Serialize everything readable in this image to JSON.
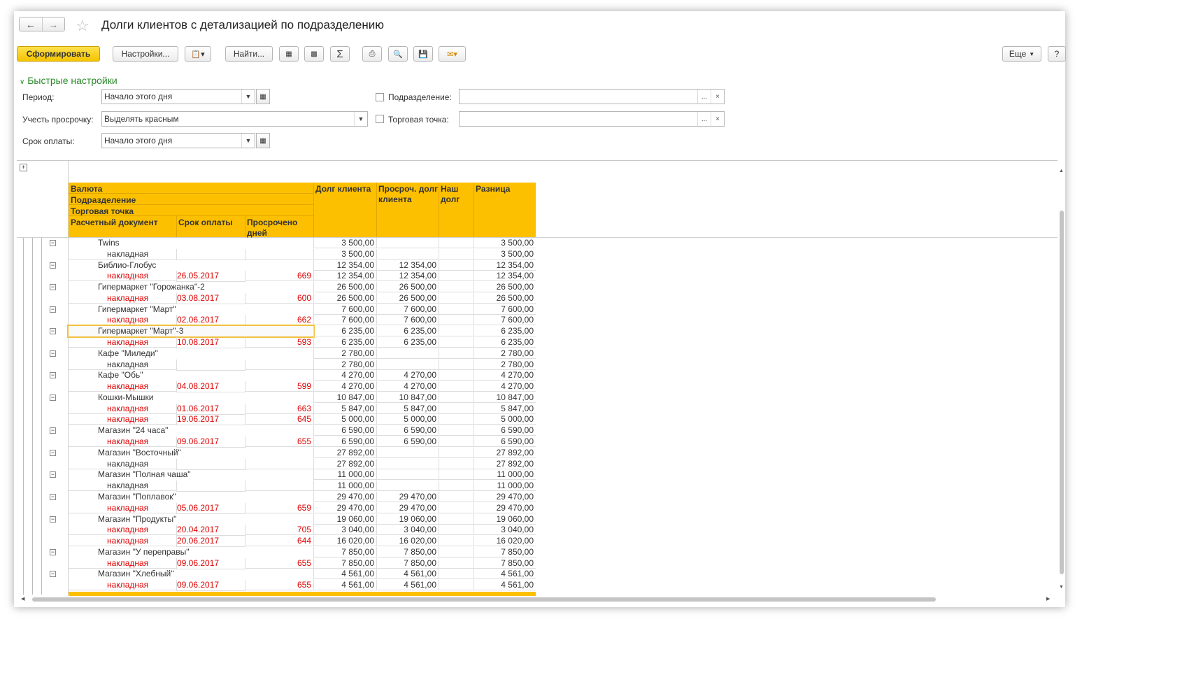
{
  "title": "Долги клиентов с детализацией по подразделению",
  "toolbar": {
    "generate": "Сформировать",
    "settings": "Настройки...",
    "find": "Найти...",
    "sigma": "Σ",
    "more": "Еще",
    "help": "?"
  },
  "quick_settings": {
    "label": "Быстрые настройки",
    "period_label": "Период:",
    "period_value": "Начало этого дня",
    "overdue_label": "Учесть просрочку:",
    "overdue_value": "Выделять красным",
    "due_label": "Срок оплаты:",
    "due_value": "Начало этого дня",
    "division_label": "Подразделение:",
    "outlet_label": "Торговая точка:",
    "dots": "...",
    "clear": "×"
  },
  "header": {
    "h_currency": "Валюта",
    "h_division": "Подразделение",
    "h_outlet": "Торговая точка",
    "h_doc": "Расчетный документ",
    "h_due": "Срок оплаты",
    "h_overdue_days": "Просрочено дней",
    "h_client_debt": "Долг клиента",
    "h_overdue_debt": "Просроч. долг клиента",
    "h_our_debt": "Наш долг",
    "h_diff": "Разница"
  },
  "rows": [
    {
      "t": "g",
      "name": "Twins",
      "debt": "3 500,00",
      "overdue": "",
      "diff": "3 500,00"
    },
    {
      "t": "d",
      "name": "накладная",
      "due": "",
      "days": "",
      "debt": "3 500,00",
      "overdue": "",
      "diff": "3 500,00",
      "red": false
    },
    {
      "t": "g",
      "name": "Библио-Глобус",
      "debt": "12 354,00",
      "overdue": "12 354,00",
      "diff": "12 354,00"
    },
    {
      "t": "d",
      "name": "накладная",
      "due": "26.05.2017",
      "days": "669",
      "debt": "12 354,00",
      "overdue": "12 354,00",
      "diff": "12 354,00",
      "red": true
    },
    {
      "t": "g",
      "name": "Гипермаркет \"Горожанка\"-2",
      "debt": "26 500,00",
      "overdue": "26 500,00",
      "diff": "26 500,00"
    },
    {
      "t": "d",
      "name": "накладная",
      "due": "03.08.2017",
      "days": "600",
      "debt": "26 500,00",
      "overdue": "26 500,00",
      "diff": "26 500,00",
      "red": true
    },
    {
      "t": "g",
      "name": "Гипермаркет \"Март\"",
      "debt": "7 600,00",
      "overdue": "7 600,00",
      "diff": "7 600,00"
    },
    {
      "t": "d",
      "name": "накладная",
      "due": "02.06.2017",
      "days": "662",
      "debt": "7 600,00",
      "overdue": "7 600,00",
      "diff": "7 600,00",
      "red": true
    },
    {
      "t": "g",
      "name": "Гипермаркет \"Март\"-3",
      "debt": "6 235,00",
      "overdue": "6 235,00",
      "diff": "6 235,00",
      "sel": true
    },
    {
      "t": "d",
      "name": "накладная",
      "due": "10.08.2017",
      "days": "593",
      "debt": "6 235,00",
      "overdue": "6 235,00",
      "diff": "6 235,00",
      "red": true
    },
    {
      "t": "g",
      "name": "Кафе \"Миледи\"",
      "debt": "2 780,00",
      "overdue": "",
      "diff": "2 780,00"
    },
    {
      "t": "d",
      "name": "накладная",
      "due": "",
      "days": "",
      "debt": "2 780,00",
      "overdue": "",
      "diff": "2 780,00",
      "red": false
    },
    {
      "t": "g",
      "name": "Кафе \"Обь\"",
      "debt": "4 270,00",
      "overdue": "4 270,00",
      "diff": "4 270,00"
    },
    {
      "t": "d",
      "name": "накладная",
      "due": "04.08.2017",
      "days": "599",
      "debt": "4 270,00",
      "overdue": "4 270,00",
      "diff": "4 270,00",
      "red": true
    },
    {
      "t": "g",
      "name": "Кошки-Мышки",
      "debt": "10 847,00",
      "overdue": "10 847,00",
      "diff": "10 847,00"
    },
    {
      "t": "d",
      "name": "накладная",
      "due": "01.06.2017",
      "days": "663",
      "debt": "5 847,00",
      "overdue": "5 847,00",
      "diff": "5 847,00",
      "red": true
    },
    {
      "t": "d",
      "name": "накладная",
      "due": "19.06.2017",
      "days": "645",
      "debt": "5 000,00",
      "overdue": "5 000,00",
      "diff": "5 000,00",
      "red": true
    },
    {
      "t": "g",
      "name": "Магазин \"24 часа\"",
      "debt": "6 590,00",
      "overdue": "6 590,00",
      "diff": "6 590,00"
    },
    {
      "t": "d",
      "name": "накладная",
      "due": "09.06.2017",
      "days": "655",
      "debt": "6 590,00",
      "overdue": "6 590,00",
      "diff": "6 590,00",
      "red": true
    },
    {
      "t": "g",
      "name": "Магазин \"Восточный\"",
      "debt": "27 892,00",
      "overdue": "",
      "diff": "27 892,00"
    },
    {
      "t": "d",
      "name": "накладная",
      "due": "",
      "days": "",
      "debt": "27 892,00",
      "overdue": "",
      "diff": "27 892,00",
      "red": false
    },
    {
      "t": "g",
      "name": "Магазин \"Полная чаша\"",
      "debt": "11 000,00",
      "overdue": "",
      "diff": "11 000,00"
    },
    {
      "t": "d",
      "name": "накладная",
      "due": "",
      "days": "",
      "debt": "11 000,00",
      "overdue": "",
      "diff": "11 000,00",
      "red": false
    },
    {
      "t": "g",
      "name": "Магазин \"Поплавок\"",
      "debt": "29 470,00",
      "overdue": "29 470,00",
      "diff": "29 470,00"
    },
    {
      "t": "d",
      "name": "накладная",
      "due": "05.06.2017",
      "days": "659",
      "debt": "29 470,00",
      "overdue": "29 470,00",
      "diff": "29 470,00",
      "red": true
    },
    {
      "t": "g",
      "name": "Магазин \"Продукты\"",
      "debt": "19 060,00",
      "overdue": "19 060,00",
      "diff": "19 060,00"
    },
    {
      "t": "d",
      "name": "накладная",
      "due": "20.04.2017",
      "days": "705",
      "debt": "3 040,00",
      "overdue": "3 040,00",
      "diff": "3 040,00",
      "red": true
    },
    {
      "t": "d",
      "name": "накладная",
      "due": "20.06.2017",
      "days": "644",
      "debt": "16 020,00",
      "overdue": "16 020,00",
      "diff": "16 020,00",
      "red": true
    },
    {
      "t": "g",
      "name": "Магазин \"У переправы\"",
      "debt": "7 850,00",
      "overdue": "7 850,00",
      "diff": "7 850,00"
    },
    {
      "t": "d",
      "name": "накладная",
      "due": "09.06.2017",
      "days": "655",
      "debt": "7 850,00",
      "overdue": "7 850,00",
      "diff": "7 850,00",
      "red": true
    },
    {
      "t": "g",
      "name": "Магазин \"Хлебный\"",
      "debt": "4 561,00",
      "overdue": "4 561,00",
      "diff": "4 561,00"
    },
    {
      "t": "d",
      "name": "накладная",
      "due": "09.06.2017",
      "days": "655",
      "debt": "4 561,00",
      "overdue": "4 561,00",
      "diff": "4 561,00",
      "red": true
    }
  ],
  "colors": {
    "header": "#fdc000",
    "overdue_text": "#e00000",
    "accent_green": "#2a8a2a"
  }
}
